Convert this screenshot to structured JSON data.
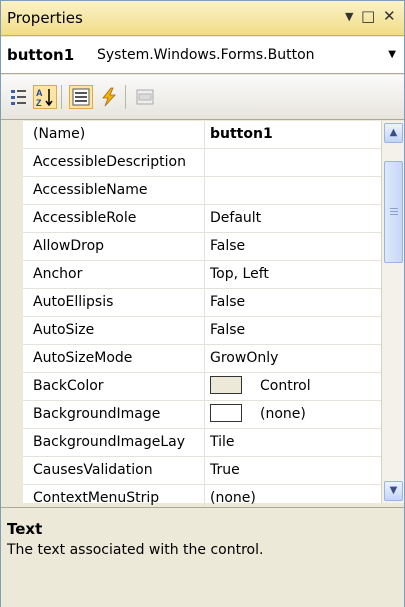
{
  "window": {
    "title": "Properties"
  },
  "selector": {
    "name": "button1",
    "type": "System.Windows.Forms.Button"
  },
  "grid": {
    "rows": [
      {
        "name": "(Name)",
        "value": "button1",
        "bold": true
      },
      {
        "name": "AccessibleDescription",
        "value": ""
      },
      {
        "name": "AccessibleName",
        "value": ""
      },
      {
        "name": "AccessibleRole",
        "value": "Default"
      },
      {
        "name": "AllowDrop",
        "value": "False"
      },
      {
        "name": "Anchor",
        "value": "Top, Left"
      },
      {
        "name": "AutoEllipsis",
        "value": "False"
      },
      {
        "name": "AutoSize",
        "value": "False"
      },
      {
        "name": "AutoSizeMode",
        "value": "GrowOnly"
      },
      {
        "name": "BackColor",
        "value": "Control",
        "swatch": "#ece9d8"
      },
      {
        "name": "BackgroundImage",
        "value": "(none)",
        "swatch": "#ffffff"
      },
      {
        "name": "BackgroundImageLay",
        "value": "Tile"
      },
      {
        "name": "CausesValidation",
        "value": "True"
      },
      {
        "name": "ContextMenuStrip",
        "value": "(none)"
      }
    ]
  },
  "description": {
    "title": "Text",
    "text": "The text associated with the control."
  },
  "icons": {
    "categorized": "categorized-icon",
    "alphabetical": "alphabetical-icon",
    "properties": "properties-icon",
    "events": "events-icon",
    "property_pages": "property-pages-icon"
  }
}
